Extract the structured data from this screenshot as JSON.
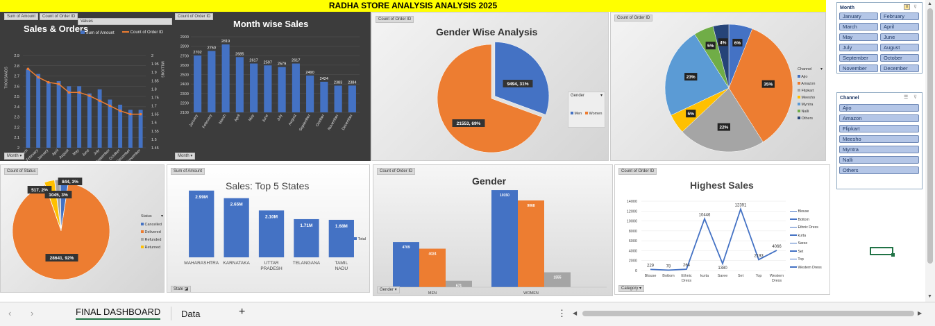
{
  "title": "RADHA STORE ANALYSIS ANALYSIS 2025",
  "sheet_tabs": {
    "active": "FINAL DASHBOARD",
    "other": "Data",
    "add": "+"
  },
  "colors": {
    "blue": "#4472c4",
    "orange": "#ed7d31",
    "gray": "#a5a5a5",
    "yellow": "#ffc000",
    "green": "#70ad47",
    "navy": "#264478",
    "lightblue": "#5b9bd5",
    "dark": "#3a3a3a",
    "yellowbar": "#ffff00"
  },
  "c1": {
    "title": "Sales & Orders",
    "btn_amount": "Sum of Amount",
    "btn_count": "Count of Order ID",
    "btn_values": "Values",
    "btn_month": "Month",
    "legend_amount": "Sum of Amount",
    "legend_count": "Count of Order ID",
    "ylabel_left": "THOUSANDS",
    "ylabel_right": "MILLIONS"
  },
  "c2": {
    "title": "Month wise Sales",
    "btn": "Count of Order ID",
    "btn_month": "Month"
  },
  "c3": {
    "title": "Gender Wise Analysis",
    "btn": "Count of Order ID",
    "legend_title": "Gender",
    "legend_men": "Men",
    "legend_women": "Women",
    "label_men": "9494, 31%",
    "label_women": "21553, 69%"
  },
  "c4": {
    "btn": "Count of Order ID",
    "legend_title": "Channel"
  },
  "c5": {
    "btn": "Count of Status",
    "legend_title": "Status",
    "labels": [
      "844, 3%",
      "517, 2%",
      "1045, 3%",
      "28641, 92%"
    ]
  },
  "c6": {
    "title": "Sales: Top 5 States",
    "btn": "Sum of Amount",
    "btn_state": "State",
    "legend": "Total"
  },
  "c7": {
    "title": "Gender",
    "btn": "Count of Order ID",
    "btn_gender": "Gender"
  },
  "c8": {
    "title": "Highest Sales",
    "btn": "Count of Order ID",
    "btn_category": "Category"
  },
  "slicer_month": {
    "header": "Month",
    "items": [
      "January",
      "February",
      "March",
      "April",
      "May",
      "June",
      "July",
      "August",
      "September",
      "October",
      "November",
      "December"
    ]
  },
  "slicer_channel": {
    "header": "Channel",
    "items": [
      "Ajio",
      "Amazon",
      "Flipkart",
      "Meesho",
      "Myntra",
      "Nalli",
      "Others"
    ]
  },
  "chart_data": [
    {
      "type": "bar",
      "title": "Sales & Orders",
      "categories": [
        "March",
        "February",
        "January",
        "April",
        "August",
        "May",
        "June",
        "July",
        "September",
        "October",
        "December",
        "November"
      ],
      "series": [
        {
          "name": "Sum of Amount",
          "values": [
            2.77,
            2.72,
            2.64,
            2.65,
            2.6,
            2.6,
            2.53,
            2.57,
            2.47,
            2.42,
            2.37,
            2.37
          ]
        },
        {
          "name": "Count of Order ID",
          "values": [
            1.92,
            1.87,
            1.84,
            1.83,
            1.78,
            1.78,
            1.76,
            1.73,
            1.7,
            1.67,
            1.65,
            1.65
          ]
        }
      ],
      "ylim_left": [
        2.0,
        2.9
      ],
      "yticks_left": [
        "2",
        "2.1",
        "2.2",
        "2.3",
        "2.4",
        "2.5",
        "2.6",
        "2.7",
        "2.8",
        "2.9"
      ],
      "ylim_right": [
        1.45,
        2.0
      ],
      "yticks_right": [
        "1.45",
        "1.5",
        "1.55",
        "1.6",
        "1.65",
        "1.7",
        "1.75",
        "1.8",
        "1.85",
        "1.9",
        "1.95",
        "2"
      ],
      "ylabel": "THOUSANDS"
    },
    {
      "type": "bar",
      "title": "Month wise Sales",
      "categories": [
        "January",
        "February",
        "March",
        "April",
        "May",
        "June",
        "July",
        "August",
        "September",
        "October",
        "November",
        "December"
      ],
      "values": [
        2702,
        2750,
        2819,
        2685,
        2617,
        2597,
        2579,
        2617,
        2490,
        2424,
        2383,
        2384
      ],
      "ylim": [
        2100,
        2900
      ],
      "yticks": [
        "2100",
        "2200",
        "2300",
        "2400",
        "2500",
        "2600",
        "2700",
        "2800",
        "2900"
      ]
    },
    {
      "type": "pie",
      "title": "Gender Wise Analysis",
      "categories": [
        "Men",
        "Women"
      ],
      "values": [
        9494,
        21553
      ]
    },
    {
      "type": "pie",
      "categories": [
        "Ajio",
        "Amazon",
        "Flipkart",
        "Meesho",
        "Myntra",
        "Nalli",
        "Others"
      ],
      "values": [
        6,
        35,
        22,
        5,
        23,
        5,
        4
      ],
      "labels": [
        "6%",
        "35%",
        "22%",
        "5%",
        "23%",
        "5%",
        "4%"
      ]
    },
    {
      "type": "pie",
      "categories": [
        "Cancelled",
        "Delivered",
        "Refunded",
        "Returned"
      ],
      "values": [
        844,
        28641,
        517,
        1045
      ]
    },
    {
      "type": "bar",
      "title": "Sales: Top 5 States",
      "categories": [
        "MAHARASHTRA",
        "KARNATAKA",
        "UTTAR PRADESH",
        "TELANGANA",
        "TAMIL NADU"
      ],
      "values": [
        2.99,
        2.65,
        2.1,
        1.71,
        1.68
      ],
      "labels": [
        "2.99M",
        "2.65M",
        "2.10M",
        "1.71M",
        "1.68M"
      ],
      "series_name": "Total"
    },
    {
      "type": "bar",
      "title": "Gender",
      "categories": [
        "MEN",
        "WOMEN"
      ],
      "series": [
        {
          "values": [
            4709,
            10150
          ]
        },
        {
          "values": [
            4024,
            9068
          ]
        },
        {
          "values": [
            671,
            1555
          ]
        }
      ]
    },
    {
      "type": "line",
      "title": "Highest Sales",
      "categories": [
        "Blouse",
        "Bottom",
        "Ethnic Dress",
        "kurta",
        "Saree",
        "Set",
        "Top",
        "Western Dress"
      ],
      "values": [
        229,
        78,
        264,
        10446,
        1380,
        12391,
        2193,
        4066
      ],
      "ylim": [
        0,
        14000
      ],
      "yticks": [
        "0",
        "2000",
        "4000",
        "6000",
        "8000",
        "10000",
        "12000",
        "14000"
      ],
      "legend": [
        "Blouse",
        "Bottom",
        "Ethnic Dress",
        "kurta",
        "Saree",
        "Set",
        "Top",
        "Western Dress"
      ]
    }
  ]
}
